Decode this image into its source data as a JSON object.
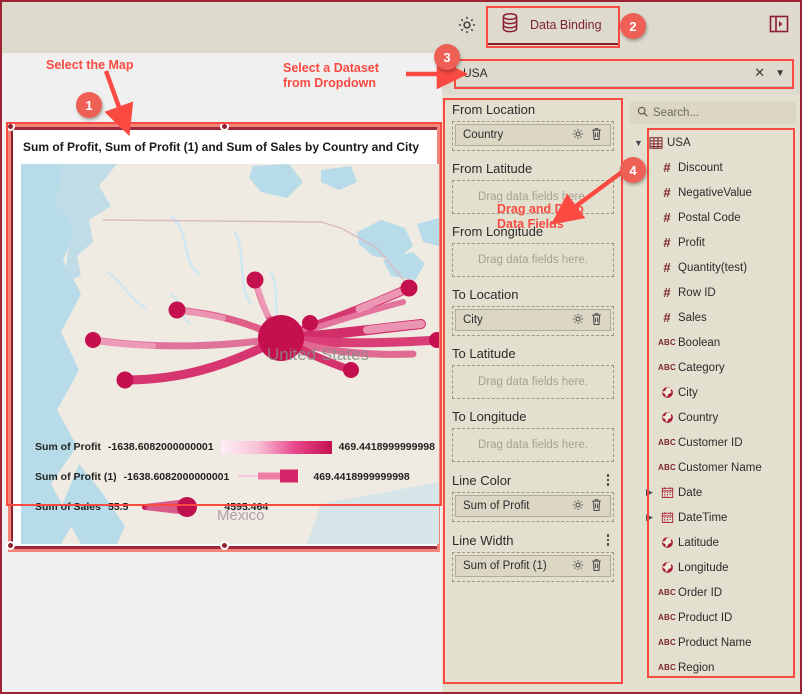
{
  "toolbar": {
    "gear_icon": "gear-icon",
    "tab_label": "Data Binding",
    "tab_icon": "database-icon",
    "collapse_icon": "panel-expand-icon"
  },
  "dataset_dropdown": {
    "value": "USA",
    "clear_icon": "close-icon",
    "caret_icon": "chevron-down-icon"
  },
  "annotations": [
    {
      "number": "1",
      "text": "Select the Map"
    },
    {
      "number": "2",
      "text": ""
    },
    {
      "number": "3",
      "text": "Select a Dataset\nfrom Dropdown"
    },
    {
      "number": "4",
      "text": "Drag and Drop\nData Fields"
    }
  ],
  "widget": {
    "title": "Sum of Profit, Sum of Profit (1) and Sum of Sales by Country and City",
    "map_labels": [
      "United States",
      "México"
    ]
  },
  "chart_data": {
    "type": "map",
    "title": "Sum of Profit, Sum of Profit (1) and Sum of Sales by Country and City",
    "legends": [
      {
        "name": "Sum of Profit",
        "min": "-1638.6082000000001",
        "max": "469.4418999999998",
        "encoding": "line-color-gradient"
      },
      {
        "name": "Sum of Profit (1)",
        "min": "-1638.6082000000001",
        "max": "469.4418999999998",
        "encoding": "line-width-gradient"
      },
      {
        "name": "Sum of Sales",
        "min": "55.5",
        "max": "4595.464",
        "encoding": "bubble-size"
      }
    ]
  },
  "shelves": [
    {
      "label": "From Location",
      "menu": false,
      "field": "Country",
      "placeholder": "Drag data fields here."
    },
    {
      "label": "From Latitude",
      "menu": false,
      "field": null,
      "placeholder": "Drag data fields here."
    },
    {
      "label": "From Longitude",
      "menu": false,
      "field": null,
      "placeholder": "Drag data fields here."
    },
    {
      "label": "To Location",
      "menu": false,
      "field": "City",
      "placeholder": "Drag data fields here."
    },
    {
      "label": "To Latitude",
      "menu": false,
      "field": null,
      "placeholder": "Drag data fields here."
    },
    {
      "label": "To Longitude",
      "menu": false,
      "field": null,
      "placeholder": "Drag data fields here."
    },
    {
      "label": "Line Color",
      "menu": true,
      "field": "Sum of Profit",
      "placeholder": "Drag data fields here."
    },
    {
      "label": "Line Width",
      "menu": true,
      "field": "Sum of Profit (1)",
      "placeholder": "Drag data fields here."
    }
  ],
  "field_panel": {
    "search_placeholder": "Search...",
    "search_icon": "search-icon",
    "root": {
      "label": "USA",
      "icon": "table-icon",
      "caret": "chevron-down-icon"
    },
    "fields": [
      {
        "label": "Discount",
        "type": "numeric",
        "expand": false
      },
      {
        "label": "NegativeValue",
        "type": "numeric",
        "expand": false
      },
      {
        "label": "Postal Code",
        "type": "numeric",
        "expand": false
      },
      {
        "label": "Profit",
        "type": "numeric",
        "expand": false
      },
      {
        "label": "Quantity(test)",
        "type": "numeric",
        "expand": false
      },
      {
        "label": "Row ID",
        "type": "numeric",
        "expand": false
      },
      {
        "label": "Sales",
        "type": "numeric",
        "expand": false
      },
      {
        "label": "Boolean",
        "type": "text",
        "expand": false
      },
      {
        "label": "Category",
        "type": "text",
        "expand": false
      },
      {
        "label": "City",
        "type": "geo",
        "expand": false
      },
      {
        "label": "Country",
        "type": "geo",
        "expand": false
      },
      {
        "label": "Customer ID",
        "type": "text",
        "expand": false
      },
      {
        "label": "Customer Name",
        "type": "text",
        "expand": false
      },
      {
        "label": "Date",
        "type": "date",
        "expand": true
      },
      {
        "label": "DateTime",
        "type": "date",
        "expand": true
      },
      {
        "label": "Latitude",
        "type": "geo",
        "expand": false
      },
      {
        "label": "Longitude",
        "type": "geo",
        "expand": false
      },
      {
        "label": "Order ID",
        "type": "text",
        "expand": false
      },
      {
        "label": "Product ID",
        "type": "text",
        "expand": false
      },
      {
        "label": "Product Name",
        "type": "text",
        "expand": false
      },
      {
        "label": "Region",
        "type": "text",
        "expand": false
      }
    ]
  },
  "colors": {
    "accent": "#8c1f2f",
    "panel": "#e4e0cf",
    "annotation": "#fa4a42",
    "badge": "#ee6055",
    "selection": "#f4837a"
  }
}
